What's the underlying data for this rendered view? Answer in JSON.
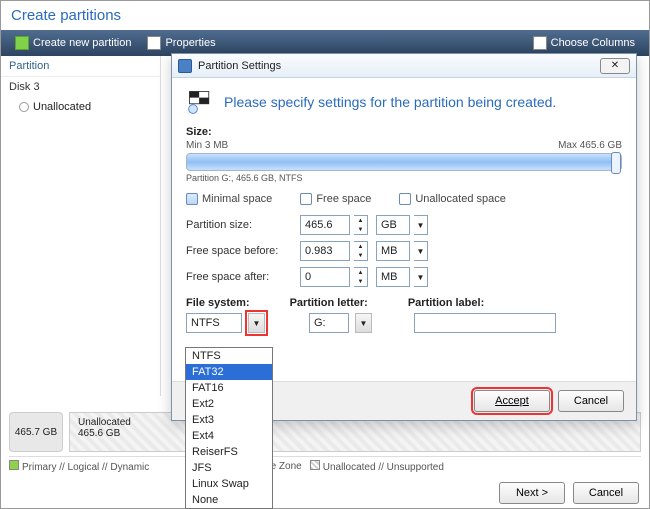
{
  "title": "Create partitions",
  "toolbar": {
    "create": "Create new partition",
    "properties": "Properties",
    "choose_columns": "Choose Columns"
  },
  "sidebar": {
    "header": "Partition",
    "disk": "Disk 3",
    "item1": "Unallocated"
  },
  "disk_strip": {
    "size": "465.7 GB",
    "alloc_title": "Unallocated",
    "alloc_size": "465.6 GB"
  },
  "legend": {
    "a": "Primary // Logical // Dynamic",
    "b": "re Zone",
    "c": "Unallocated // Unsupported"
  },
  "footer": {
    "next": "Next >",
    "cancel": "Cancel"
  },
  "dialog": {
    "title": "Partition Settings",
    "prompt": "Please specify settings for the partition being created.",
    "size_label": "Size:",
    "min": "Min 3 MB",
    "max": "Max 465.6 GB",
    "slider_caption": "Partition G:, 465.6 GB, NTFS",
    "chk_min": "Minimal space",
    "chk_free": "Free space",
    "chk_unalloc": "Unallocated space",
    "psize_label": "Partition size:",
    "psize_val": "465.6",
    "psize_unit": "GB",
    "fsb_label": "Free space before:",
    "fsb_val": "0.983",
    "fsb_unit": "MB",
    "fsa_label": "Free space after:",
    "fsa_val": "0",
    "fsa_unit": "MB",
    "fs_label": "File system:",
    "pl_label": "Partition letter:",
    "plb_label": "Partition label:",
    "fs_val": "NTFS",
    "pl_val": "G:",
    "accept": "Accept",
    "cancel": "Cancel"
  },
  "dropdown": {
    "o0": "NTFS",
    "o1": "FAT32",
    "o2": "FAT16",
    "o3": "Ext2",
    "o4": "Ext3",
    "o5": "Ext4",
    "o6": "ReiserFS",
    "o7": "JFS",
    "o8": "Linux Swap",
    "o9": "None"
  }
}
